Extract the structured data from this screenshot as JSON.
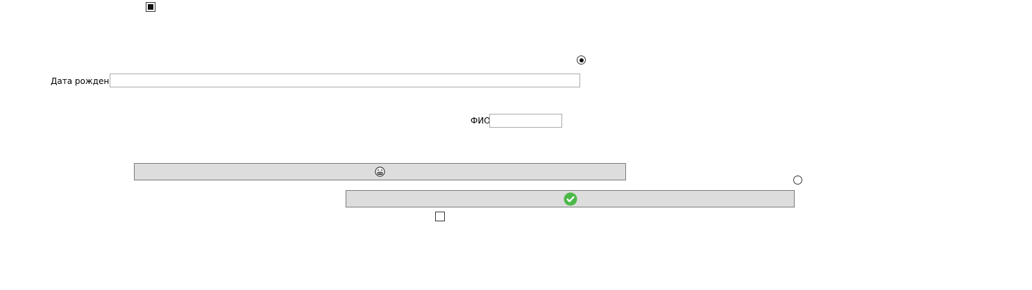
{
  "checkboxes": [
    {
      "id": "checkbox-top",
      "checked": true
    },
    {
      "id": "checkbox-bottom",
      "checked": false
    }
  ],
  "radios": [
    {
      "id": "radio-top",
      "checked": true
    },
    {
      "id": "radio-right",
      "checked": false
    }
  ],
  "birthdate": {
    "label": "Дата рождения",
    "value": "",
    "placeholder": ""
  },
  "fio": {
    "label": "ФИО",
    "value": "",
    "placeholder": ""
  },
  "buttons": {
    "emoji_button_icon": "grimacing-face-icon",
    "confirm_button_icon": "green-checkmark-icon"
  },
  "colors": {
    "button_bg": "#dddddd",
    "button_border": "#7a7a7a",
    "input_border": "#a9a9a9",
    "check_green": "#4cb848"
  }
}
